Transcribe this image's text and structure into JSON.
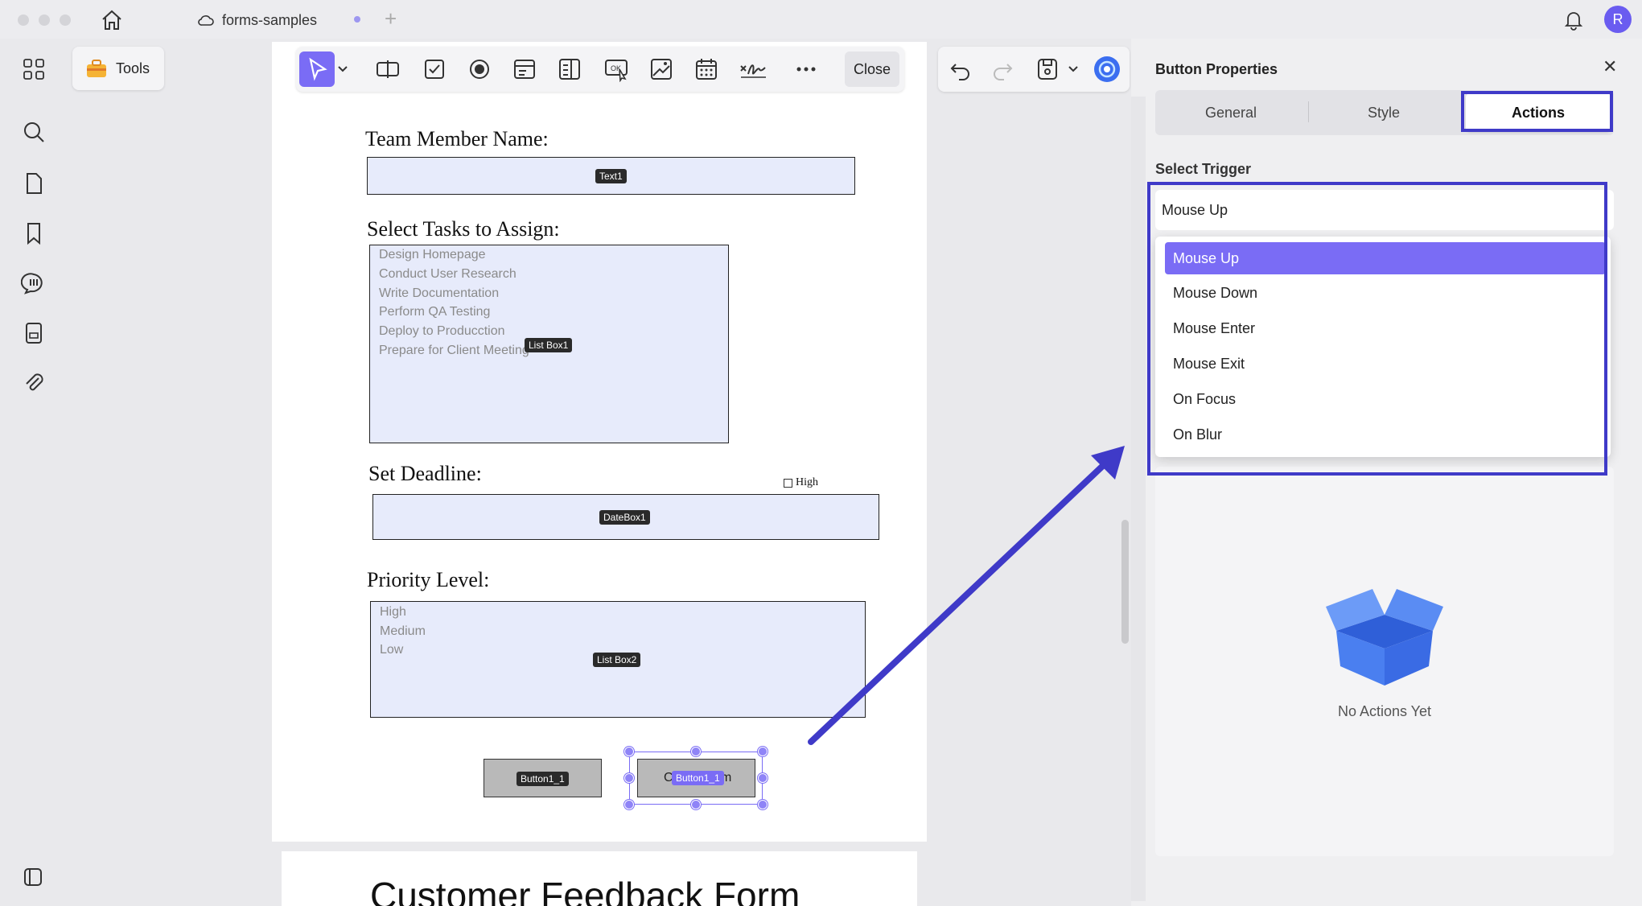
{
  "titlebar": {
    "tab_label": "forms-samples",
    "avatar_initial": "R"
  },
  "tools": {
    "label": "Tools"
  },
  "toolbar": {
    "close_label": "Close"
  },
  "form": {
    "team_member_label": "Team Member Name:",
    "text1_tag": "Text1",
    "select_tasks_label": "Select Tasks to Assign:",
    "tasks": [
      "Design Homepage",
      "Conduct User Research",
      "Write Documentation",
      "Perform QA Testing",
      "Deploy to Producction",
      "Prepare for Client Meeting"
    ],
    "listbox1_tag": "List Box1",
    "deadline_label": "Set Deadline:",
    "checkbox_high_label": "High",
    "datebox_tag": "DateBox1",
    "priority_label": "Priority Level:",
    "priorities": [
      "High",
      "Medium",
      "Low"
    ],
    "listbox2_tag": "List Box2",
    "button1_tag": "Button1_1",
    "button2_text_left": "C",
    "button2_text_right": "m",
    "button2_tag": "Button1_1"
  },
  "next_page": {
    "title": "Customer Feedback Form"
  },
  "panel": {
    "title": "Button Properties",
    "tabs": [
      "General",
      "Style",
      "Actions"
    ],
    "active_tab": "Actions",
    "select_trigger_label": "Select Trigger",
    "selected_trigger": "Mouse Up",
    "trigger_options": [
      "Mouse Up",
      "Mouse Down",
      "Mouse Enter",
      "Mouse Exit",
      "On Focus",
      "On Blur"
    ],
    "empty_state": "No Actions Yet"
  },
  "colors": {
    "accent": "#7a6cf5",
    "annotation": "#3f3ac8",
    "field_fill": "#e7ebfb"
  }
}
